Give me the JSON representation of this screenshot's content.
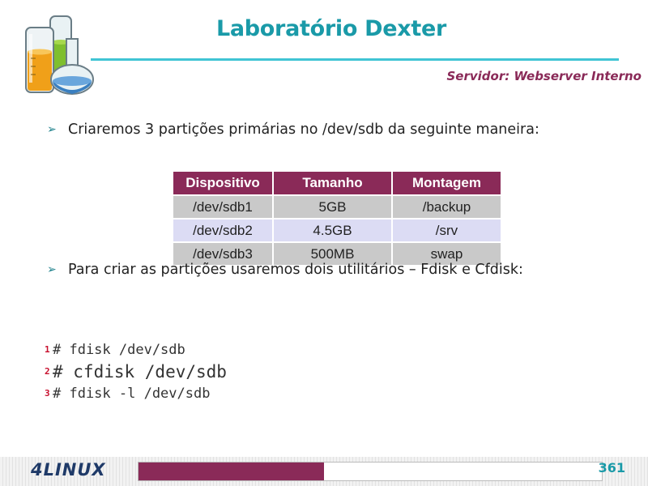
{
  "header": {
    "title": "Laboratório Dexter",
    "subtitle": "Servidor: Webserver Interno",
    "logo_icon": "lab-flasks-icon",
    "accent_color": "#1a9aa8",
    "brand_color": "#8a2a58"
  },
  "bullets": [
    {
      "icon": "arrow-bullet-icon",
      "text": "Criaremos 3 partições primárias no /dev/sdb da seguinte maneira:"
    },
    {
      "icon": "arrow-bullet-icon",
      "text": "Para criar as partições usaremos dois utilitários – Fdisk e Cfdisk:"
    }
  ],
  "table": {
    "headers": [
      "Dispositivo",
      "Tamanho",
      "Montagem"
    ],
    "rows": [
      [
        "/dev/sdb1",
        "5GB",
        "/backup"
      ],
      [
        "/dev/sdb2",
        "4.5GB",
        "/srv"
      ],
      [
        "/dev/sdb3",
        "500MB",
        "swap"
      ]
    ]
  },
  "commands": [
    {
      "num": "1",
      "text": "# fdisk /dev/sdb"
    },
    {
      "num": "2",
      "text": "# cfdisk /dev/sdb"
    },
    {
      "num": "3",
      "text": "# fdisk -l /dev/sdb"
    }
  ],
  "footer": {
    "logo_text": "4LINUX",
    "page_number": "361",
    "progress_fraction": 0.4
  }
}
